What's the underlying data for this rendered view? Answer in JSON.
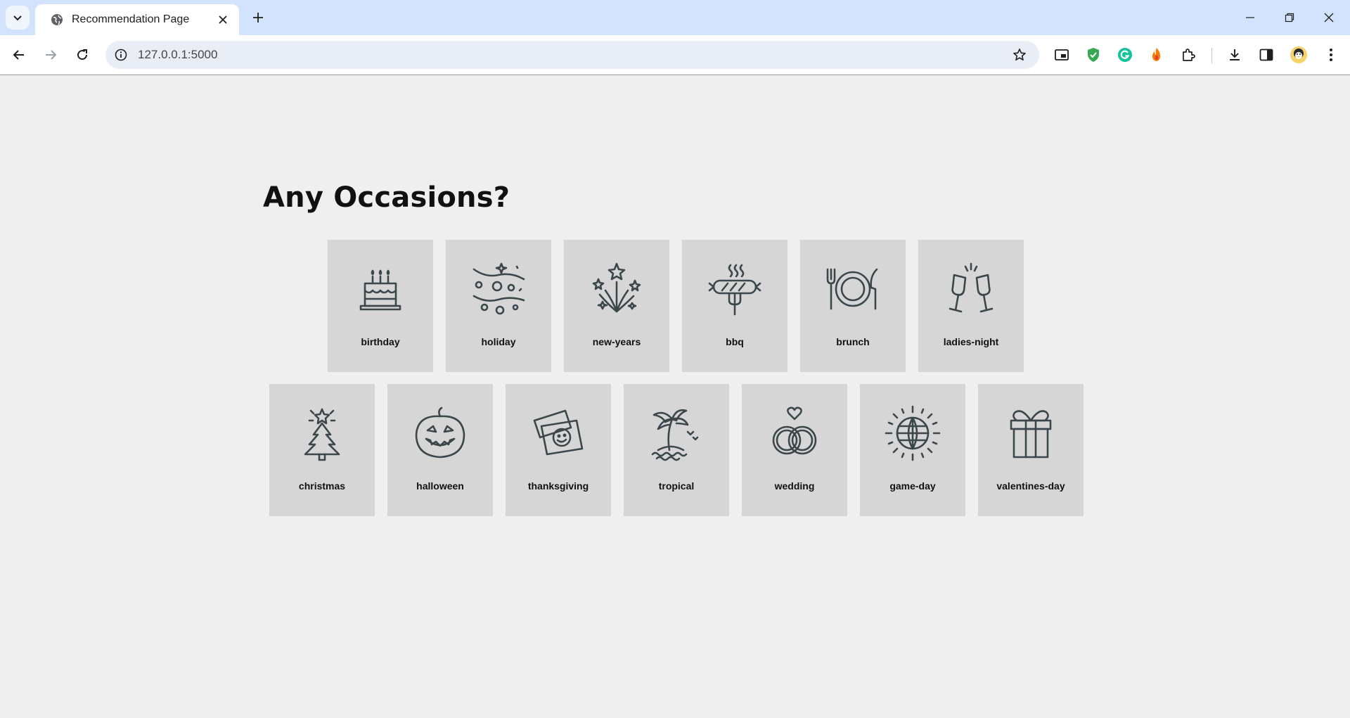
{
  "browser": {
    "tab_title": "Recommendation Page",
    "url": "127.0.0.1:5000",
    "tab_icon": "globe-icon"
  },
  "page": {
    "heading": "Any Occasions?"
  },
  "occasions": [
    {
      "label": "birthday",
      "icon": "birthday-cake-icon"
    },
    {
      "label": "holiday",
      "icon": "confetti-icon"
    },
    {
      "label": "new-years",
      "icon": "fireworks-icon"
    },
    {
      "label": "bbq",
      "icon": "sausage-fork-icon"
    },
    {
      "label": "brunch",
      "icon": "plate-cutlery-icon"
    },
    {
      "label": "ladies-night",
      "icon": "champagne-glasses-icon"
    },
    {
      "label": "christmas",
      "icon": "christmas-tree-icon"
    },
    {
      "label": "halloween",
      "icon": "pumpkin-icon"
    },
    {
      "label": "thanksgiving",
      "icon": "photos-icon"
    },
    {
      "label": "tropical",
      "icon": "palm-tree-icon"
    },
    {
      "label": "wedding",
      "icon": "wedding-rings-icon"
    },
    {
      "label": "game-day",
      "icon": "disco-ball-icon"
    },
    {
      "label": "valentines-day",
      "icon": "gift-box-icon"
    }
  ],
  "colors": {
    "tabstrip": "#d3e3fd",
    "page_background": "#efefef",
    "card_background": "#d6d6d6",
    "icon_stroke": "#3c474c"
  }
}
